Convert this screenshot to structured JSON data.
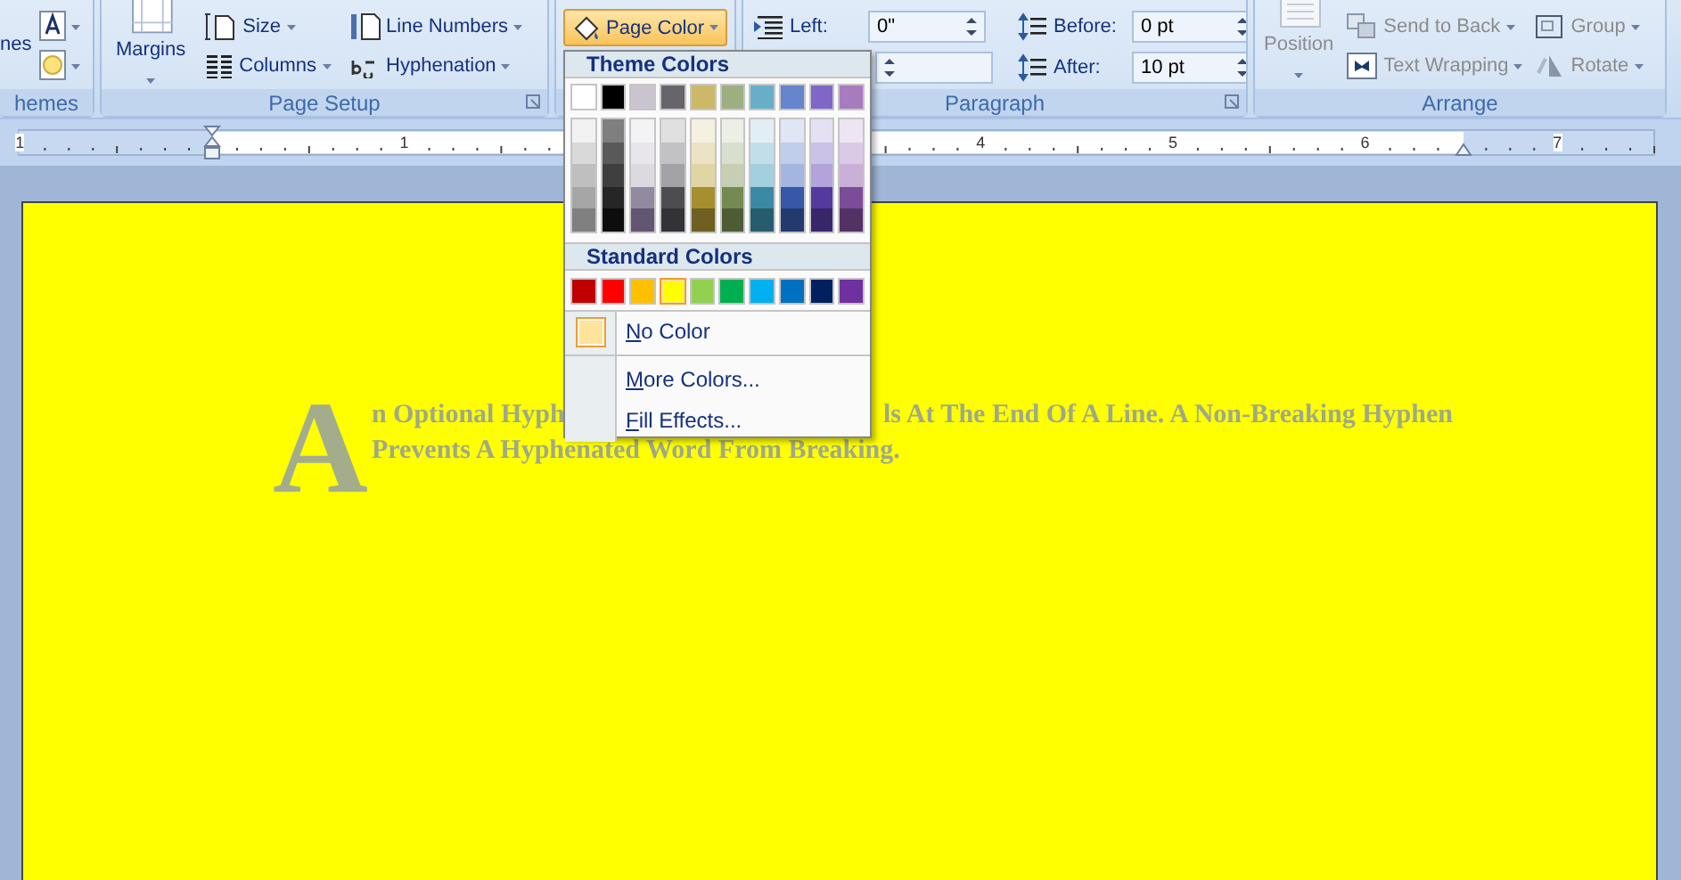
{
  "ribbon": {
    "themes_group": {
      "label": "hemes",
      "button_label": "nes"
    },
    "page_setup": {
      "label": "Page Setup",
      "margins": {
        "label": "Margins",
        "disabled": false
      },
      "buttons": [
        {
          "label": "Size",
          "kind": "size",
          "disabled": false
        },
        {
          "label": "Columns",
          "kind": "columns",
          "disabled": false
        },
        {
          "label": "Line Numbers",
          "kind": "line-numbers",
          "disabled": false
        },
        {
          "label": "Hyphenation",
          "kind": "hyphenation",
          "disabled": false
        }
      ]
    },
    "page_color": {
      "label": "Page Color",
      "expanded": true
    },
    "paragraph": {
      "label": "Paragraph",
      "indent_left": {
        "label": "Left:",
        "value": "0\""
      },
      "spacing_before": {
        "label": "Before:",
        "value": "0 pt"
      },
      "spacing_after": {
        "label": "After:",
        "value": "10 pt"
      }
    },
    "arrange": {
      "label": "Arrange",
      "position": {
        "label": "Position",
        "disabled": true
      },
      "buttons": [
        {
          "label": "Send to Back",
          "kind": "send-back",
          "disabled": true
        },
        {
          "label": "Text Wrapping",
          "kind": "wrap",
          "disabled": true
        },
        {
          "label": "Group",
          "kind": "group",
          "disabled": true
        },
        {
          "label": "Rotate",
          "kind": "rotate",
          "disabled": true
        }
      ]
    }
  },
  "ruler": {
    "numbers": [
      "1",
      "1",
      "4",
      "5",
      "6",
      "7"
    ]
  },
  "page_color_menu": {
    "theme_header": "Theme Colors",
    "theme_colors": [
      {
        "color": "#ffffff",
        "shades": [
          {
            "color": "#f2f2f2"
          },
          {
            "color": "#d9d9d9"
          },
          {
            "color": "#bfbfbf"
          },
          {
            "color": "#a6a6a6"
          },
          {
            "color": "#808080"
          }
        ]
      },
      {
        "color": "#000000",
        "shades": [
          {
            "color": "#7f7f7f"
          },
          {
            "color": "#595959"
          },
          {
            "color": "#3f3f3f"
          },
          {
            "color": "#262626"
          },
          {
            "color": "#0d0d0d"
          }
        ]
      },
      {
        "color": "#c9c4cf",
        "shades": [
          {
            "color": "#f3f2f5"
          },
          {
            "color": "#e8e6eb"
          },
          {
            "color": "#dcd9e1"
          },
          {
            "color": "#928aa1"
          },
          {
            "color": "#625672"
          }
        ]
      },
      {
        "color": "#67656b",
        "shades": [
          {
            "color": "#e0e0e1"
          },
          {
            "color": "#c2c1c4"
          },
          {
            "color": "#a3a2a6"
          },
          {
            "color": "#4d4c50"
          },
          {
            "color": "#333236"
          }
        ]
      },
      {
        "color": "#ccb968",
        "shades": [
          {
            "color": "#f5f1e1"
          },
          {
            "color": "#ebe3c3"
          },
          {
            "color": "#e0d5a4"
          },
          {
            "color": "#a78f30"
          },
          {
            "color": "#6f5f20"
          }
        ]
      },
      {
        "color": "#9daf80",
        "shades": [
          {
            "color": "#ebefe6"
          },
          {
            "color": "#d8dfcc"
          },
          {
            "color": "#c4cfb3"
          },
          {
            "color": "#758a52"
          },
          {
            "color": "#4e5c36"
          }
        ]
      },
      {
        "color": "#67afc8",
        "shades": [
          {
            "color": "#e1eff4"
          },
          {
            "color": "#c2dfe9"
          },
          {
            "color": "#a4cfde"
          },
          {
            "color": "#3b8aa5"
          },
          {
            "color": "#275c6e"
          }
        ]
      },
      {
        "color": "#6585cd",
        "shades": [
          {
            "color": "#e0e6f5"
          },
          {
            "color": "#c1ceeb"
          },
          {
            "color": "#a3b6e1"
          },
          {
            "color": "#3658a7"
          },
          {
            "color": "#243a6f"
          }
        ]
      },
      {
        "color": "#7e67c7",
        "shades": [
          {
            "color": "#e5e0f3"
          },
          {
            "color": "#cbc2e8"
          },
          {
            "color": "#b2a3dd"
          },
          {
            "color": "#54399f"
          },
          {
            "color": "#38266a"
          }
        ]
      },
      {
        "color": "#a77cbe",
        "shades": [
          {
            "color": "#ede5f2"
          },
          {
            "color": "#dbcae5"
          },
          {
            "color": "#cab0d8"
          },
          {
            "color": "#7c4c98"
          },
          {
            "color": "#523265"
          }
        ]
      }
    ],
    "standard_header": "Standard Colors",
    "standard_colors": [
      {
        "color": "#c00000",
        "selected": false
      },
      {
        "color": "#ff0000",
        "selected": false
      },
      {
        "color": "#ffc000",
        "selected": false
      },
      {
        "color": "#ffff00",
        "selected": true
      },
      {
        "color": "#92d050",
        "selected": false
      },
      {
        "color": "#00b050",
        "selected": false
      },
      {
        "color": "#00b0f0",
        "selected": false
      },
      {
        "color": "#0070c0",
        "selected": false
      },
      {
        "color": "#002060",
        "selected": false
      },
      {
        "color": "#7030a0",
        "selected": false
      }
    ],
    "items": [
      {
        "label": "No Color",
        "kind": "no-color"
      },
      {
        "label": "More Colors...",
        "kind": "plain"
      },
      {
        "label": "Fill Effects...",
        "kind": "plain"
      }
    ]
  },
  "document": {
    "drop_cap": "A",
    "line_1_start": "n Optional Hyph",
    "line_1_end": "ls At The End Of A Line. A Non-Breaking Hyphen",
    "line_2": "Prevents A Hyphenated Word From Breaking."
  }
}
